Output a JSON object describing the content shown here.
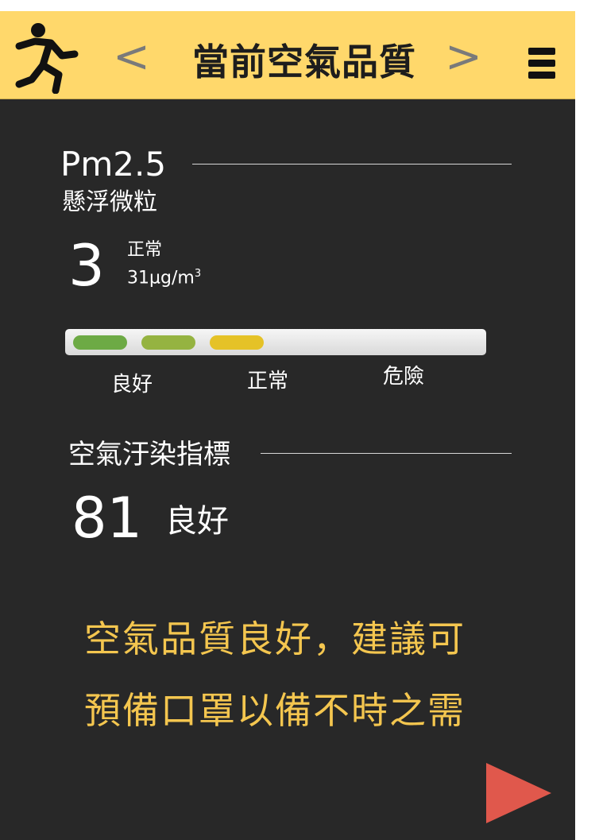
{
  "header": {
    "title": "當前空氣品質",
    "prev_label": "<",
    "next_label": ">",
    "bg_color": "#ffd86b"
  },
  "pm25": {
    "title": "Pm2.5",
    "subtitle": "懸浮微粒",
    "value": "3",
    "status": "正常",
    "concentration": "31µg/m",
    "concentration_sup": "3"
  },
  "scale": {
    "labels": [
      "良好",
      "正常",
      "危險"
    ],
    "segment_colors": [
      "#6daa45",
      "#95b341",
      "#e5c227"
    ]
  },
  "aqi": {
    "title": "空氣汙染指標",
    "value": "81",
    "status": "良好"
  },
  "advice": {
    "line1": "空氣品質良好，建議可",
    "line2": "預備口罩以備不時之需",
    "color": "#f4c64f"
  },
  "icons": {
    "runner": "running-person-icon",
    "menu": "hamburger-menu-icon",
    "play": "play-triangle-icon"
  },
  "colors": {
    "background": "#282828",
    "accent_red": "#e0584c"
  }
}
